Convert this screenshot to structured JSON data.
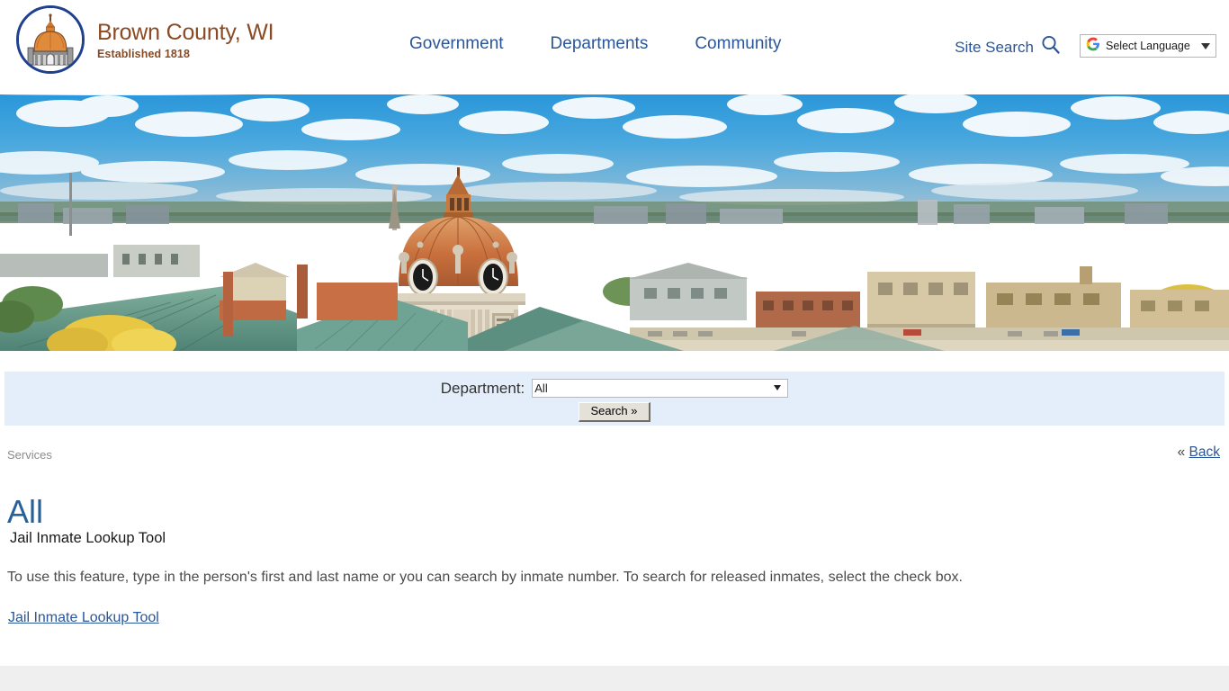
{
  "header": {
    "brand": {
      "title": "Brown County, WI",
      "subtitle": "Established 1818",
      "seal_icon": "courthouse-seal-icon"
    },
    "nav": [
      {
        "label": "Government"
      },
      {
        "label": "Departments"
      },
      {
        "label": "Community"
      }
    ],
    "site_search": {
      "label": "Site Search",
      "icon": "search-icon"
    },
    "translate": {
      "label": "Select Language",
      "icon": "google-g-icon",
      "caret_icon": "chevron-down-icon"
    }
  },
  "banner": {
    "alt": "Aerial view of the Brown County Courthouse dome and downtown Green Bay rooftops under a blue cloudy sky"
  },
  "search_band": {
    "department_label": "Department:",
    "department_value": "All",
    "department_options": [
      "All"
    ],
    "search_button": "Search »",
    "caret_icon": "chevron-down-icon"
  },
  "content": {
    "breadcrumb": "Services",
    "back": {
      "prefix": "«",
      "label": "Back"
    },
    "page_title": "All",
    "item": {
      "title": "Jail Inmate Lookup Tool",
      "description": "To use this feature, type in the person's first and last name or you can search by inmate number. To search for released inmates, select the check box.",
      "link_label": "Jail Inmate Lookup Tool"
    }
  },
  "colors": {
    "brand_brown": "#8a4b24",
    "nav_blue": "#2a5699",
    "seal_navy": "#1f3f8f",
    "band_blue": "#e4eefb",
    "title_blue": "#2a6099",
    "footer_gray": "#efefef"
  }
}
